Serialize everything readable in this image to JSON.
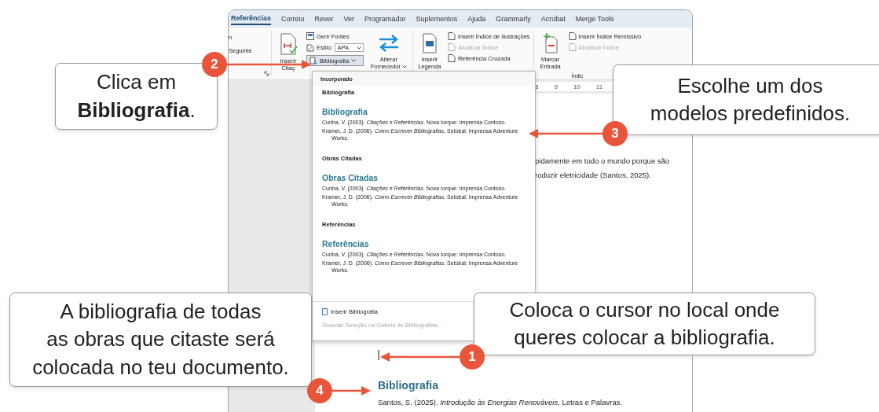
{
  "word_window": {
    "tabs": [
      {
        "label": "Referências",
        "selected": true
      },
      {
        "label": "Correio",
        "selected": false
      },
      {
        "label": "Rever",
        "selected": false
      },
      {
        "label": "Ver",
        "selected": false
      },
      {
        "label": "Programador",
        "selected": false
      },
      {
        "label": "Suplementos",
        "selected": false
      },
      {
        "label": "Ajuda",
        "selected": false
      },
      {
        "label": "Grammarly",
        "selected": false
      },
      {
        "label": "Acrobat",
        "selected": false
      },
      {
        "label": "Merge Tools",
        "selected": false
      }
    ],
    "ribbon": {
      "partial_group": {
        "top_label": "n",
        "button": "Seguinte"
      },
      "citations_group": {
        "insert_citation": [
          "Inserir",
          "Citaç"
        ],
        "manage_sources": "Gerir Fontes",
        "style_label": "Estilo:",
        "style_value": "APA",
        "bibliography_button": {
          "label": "Bibliografia",
          "expanded": true
        },
        "change_provider": [
          "Alterar",
          "Fornecedor"
        ]
      },
      "captions_group": {
        "insert_caption": [
          "Inserir",
          "Legenda"
        ],
        "items": [
          {
            "label": "Inserir Índice de Ilustrações",
            "disabled": false
          },
          {
            "label": "Atualizar Índice",
            "disabled": true
          },
          {
            "label": "Referência Cruzada",
            "disabled": false
          }
        ]
      },
      "index_group": {
        "mark_entry": [
          "Marcar",
          "Entrada"
        ],
        "items": [
          {
            "label": "Inserir Índice Remissivo",
            "disabled": false
          },
          {
            "label": "Atualizar Índice",
            "disabled": true
          }
        ],
        "group_label": "Índic"
      }
    },
    "ruler_labels": [
      "8",
      "9",
      "10",
      "11"
    ],
    "bibliography_menu": {
      "section": "Incorporado",
      "options": [
        {
          "name": "Bibliografia",
          "heading": "Bibliografia",
          "entries": [
            "Cunha, V. (2003). *Citações e Referências*. Nova Iorque: Imprensa Contoso.",
            "Kramer, J. D. (2006). *Como Escrever Bibliografias*. Setúbal: Imprensa Adventure Works."
          ]
        },
        {
          "name": "Obras Citadas",
          "heading": "Obras Citadas",
          "entries": [
            "Cunha, V. (2003). *Citações e Referências*. Nova Iorque: Imprensa Contoso.",
            "Kramer, J. D. (2006). *Como Escrever Bibliografias*. Setúbal: Imprensa Adventure Works."
          ]
        },
        {
          "name": "Referências",
          "heading": "Referências",
          "entries": [
            "Cunha, V. (2003). *Citações e Referências*. Nova Iorque: Imprensa Contoso.",
            "Kramer, J. D. (2006). *Como Escrever Bibliografias*. Setúbal: Imprensa Adventure Works."
          ]
        }
      ],
      "commands": [
        {
          "label": "Inserir Bibliografia",
          "disabled": false
        },
        {
          "label": "Guardar Seleção na Galeria de Bibliografias...",
          "disabled": true
        }
      ]
    },
    "document": {
      "text_lines": [
        "pidamente em todo o mundo porque são",
        "roduzir eletricidade (Santos, 2025)."
      ],
      "heading": "Bibliografia",
      "citation": "Santos, S. (2025). *Introdução às Energias Renováveis*. Letras e Palavras."
    }
  },
  "callouts": [
    {
      "text": "Clica em **Bibliografia**."
    },
    {
      "text": "Escolhe um dos modelos predefinidos."
    },
    {
      "text": "A bibliografia de todas as obras que citaste será colocada no teu documento."
    },
    {
      "text": "Coloca o cursor no local onde queres colocar a bibliografia."
    }
  ],
  "steps": [
    {
      "number": "2"
    },
    {
      "number": "3"
    },
    {
      "number": "1"
    },
    {
      "number": "4"
    }
  ]
}
